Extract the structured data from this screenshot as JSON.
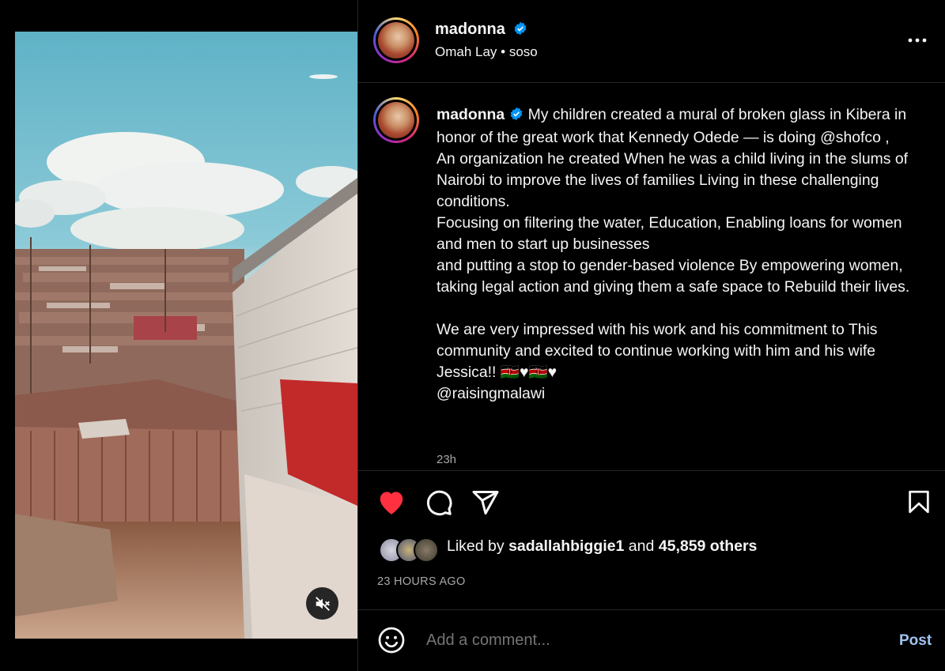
{
  "post": {
    "username": "madonna",
    "audio": "Omah Lay • soso",
    "caption": "My children created a mural of broken glass in Kibera in honor of the great work that Kennedy Odede — is doing @shofco ,\nAn organization he created When he was a child living in the slums of Nairobi to improve the lives of families Living in these challenging conditions.\nFocusing on filtering the water, Education, Enabling loans for women and men to start up businesses\nand putting a stop to gender-based violence By empowering women, taking legal action and giving them a safe space to Rebuild their lives.\n\nWe are very impressed with his work and his commitment to This community and excited to continue working with him and his wife Jessica!! 🇰🇪♥🇰🇪♥\n@raisingmalawi",
    "caption_time": "23h",
    "liked_by_prefix": "Liked by ",
    "liked_by_user": "sadallahbiggie1",
    "liked_by_mid": " and ",
    "likes_count": "45,859 others",
    "posted_ago": "23 HOURS AGO"
  },
  "comment": {
    "placeholder": "Add a comment...",
    "post_label": "Post"
  },
  "icons": {
    "like": "heart-icon",
    "comment": "comment-icon",
    "share": "share-icon",
    "save": "bookmark-icon",
    "mute": "muted-speaker-icon",
    "emoji": "emoji-icon",
    "more": "more-options-icon",
    "verified": "verified-badge-icon"
  },
  "colors": {
    "like": "#ff3040",
    "verified": "#0095f6",
    "post_button": "#a0c4f0",
    "secondary_text": "#a8a8a8"
  }
}
